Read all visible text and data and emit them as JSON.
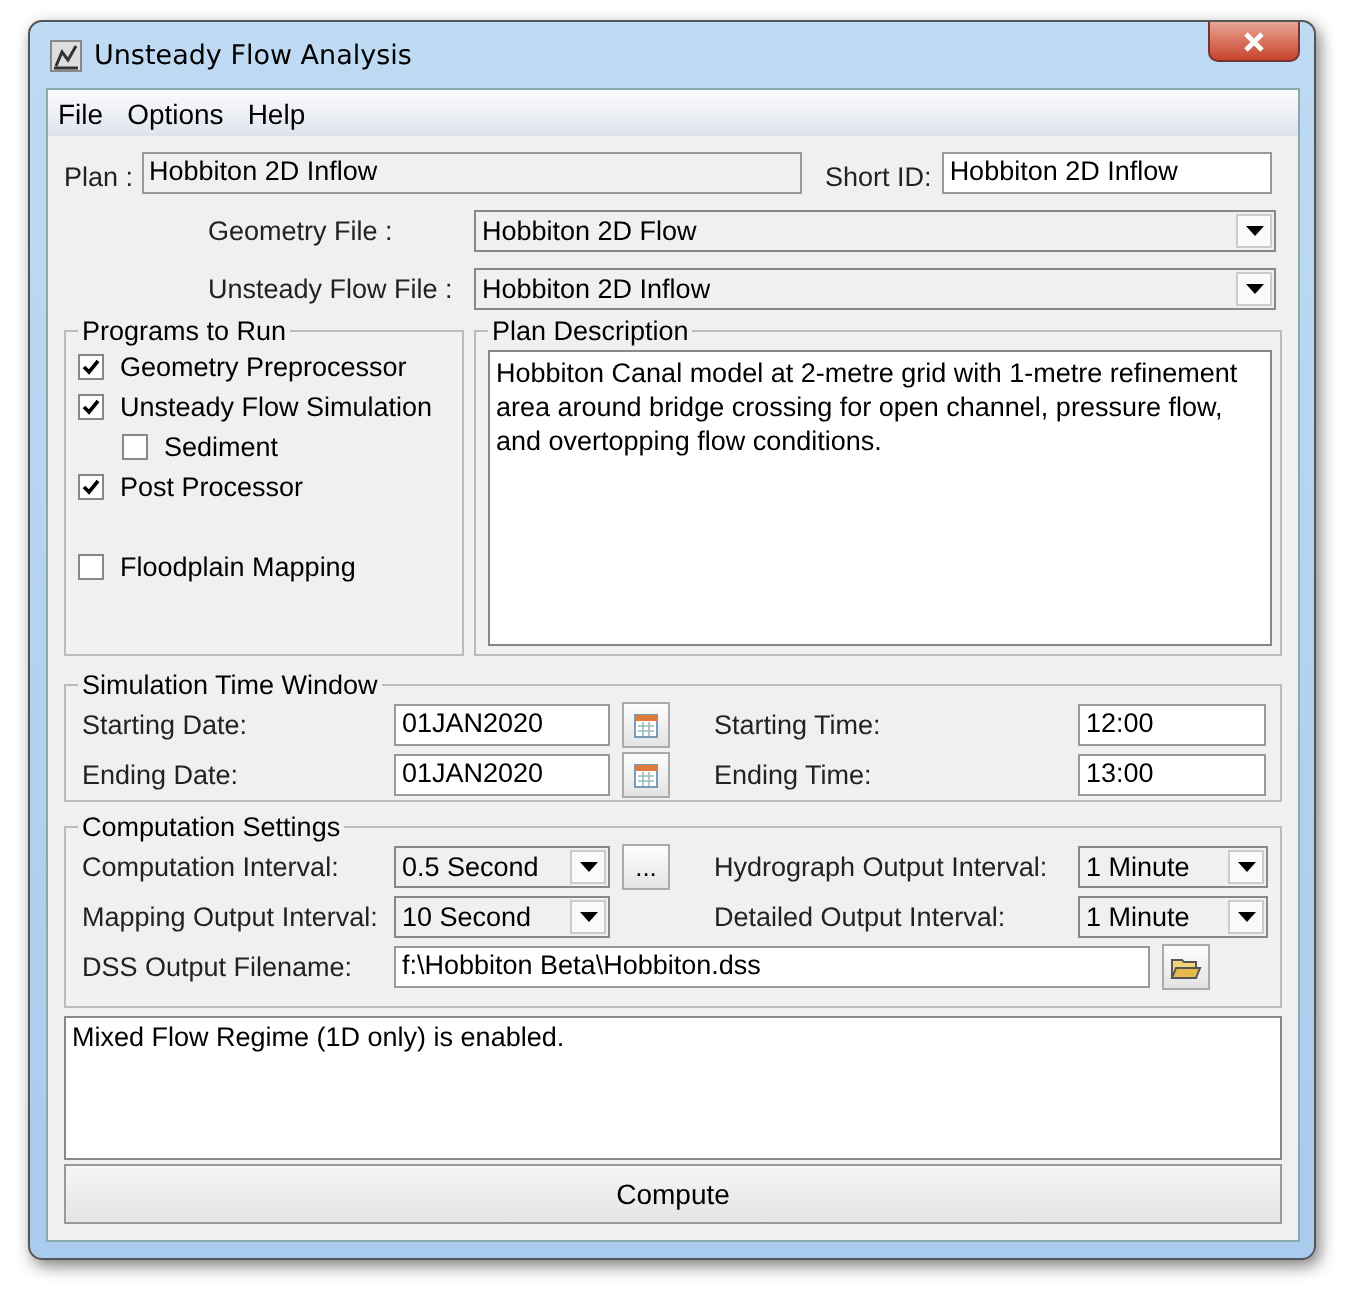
{
  "window": {
    "title": "Unsteady Flow Analysis"
  },
  "menu": [
    "File",
    "Options",
    "Help"
  ],
  "plan": {
    "label": "Plan :",
    "value": "Hobbiton 2D Inflow"
  },
  "short_id": {
    "label": "Short ID:",
    "value": "Hobbiton 2D Inflow"
  },
  "file_selectors": [
    {
      "label": "Geometry File :",
      "value": "Hobbiton 2D Flow"
    },
    {
      "label": "Unsteady Flow File :",
      "value": "Hobbiton 2D Inflow"
    }
  ],
  "programs": {
    "title": "Programs to Run",
    "items": [
      {
        "label": "Geometry Preprocessor",
        "checked": true
      },
      {
        "label": "Unsteady Flow Simulation",
        "checked": true,
        "children": [
          {
            "label": "Sediment",
            "checked": false
          }
        ]
      },
      {
        "label": "Post Processor",
        "checked": true
      },
      {
        "label": "Floodplain Mapping",
        "checked": false
      }
    ]
  },
  "plan_description": {
    "title": "Plan Description",
    "text": "Hobbiton Canal model at 2-metre grid with 1-metre refinement area around bridge crossing for open channel, pressure flow, and overtopping flow conditions."
  },
  "simulation_time_window": {
    "title": "Simulation Time Window",
    "rows": [
      {
        "date_label": "Starting Date:",
        "date": "01JAN2020",
        "time_label": "Starting Time:",
        "time": "12:00"
      },
      {
        "date_label": "Ending Date:",
        "date": "01JAN2020",
        "time_label": "Ending Time:",
        "time": "13:00"
      }
    ]
  },
  "computation_settings": {
    "title": "Computation Settings",
    "rows": [
      {
        "label": "Computation Interval:",
        "value": "0.5 Second",
        "button": "...",
        "right_label": "Hydrograph Output Interval:",
        "right_value": "1 Minute"
      },
      {
        "label": "Mapping Output Interval:",
        "value": "10 Second",
        "right_label": "Detailed Output Interval:",
        "right_value": "1 Minute"
      }
    ],
    "dss_output": {
      "label": "DSS Output Filename:",
      "value": "f:\\Hobbiton Beta\\Hobbiton.dss"
    }
  },
  "messages": [
    "Mixed Flow Regime (1D only) is enabled."
  ],
  "compute_button": "Compute"
}
